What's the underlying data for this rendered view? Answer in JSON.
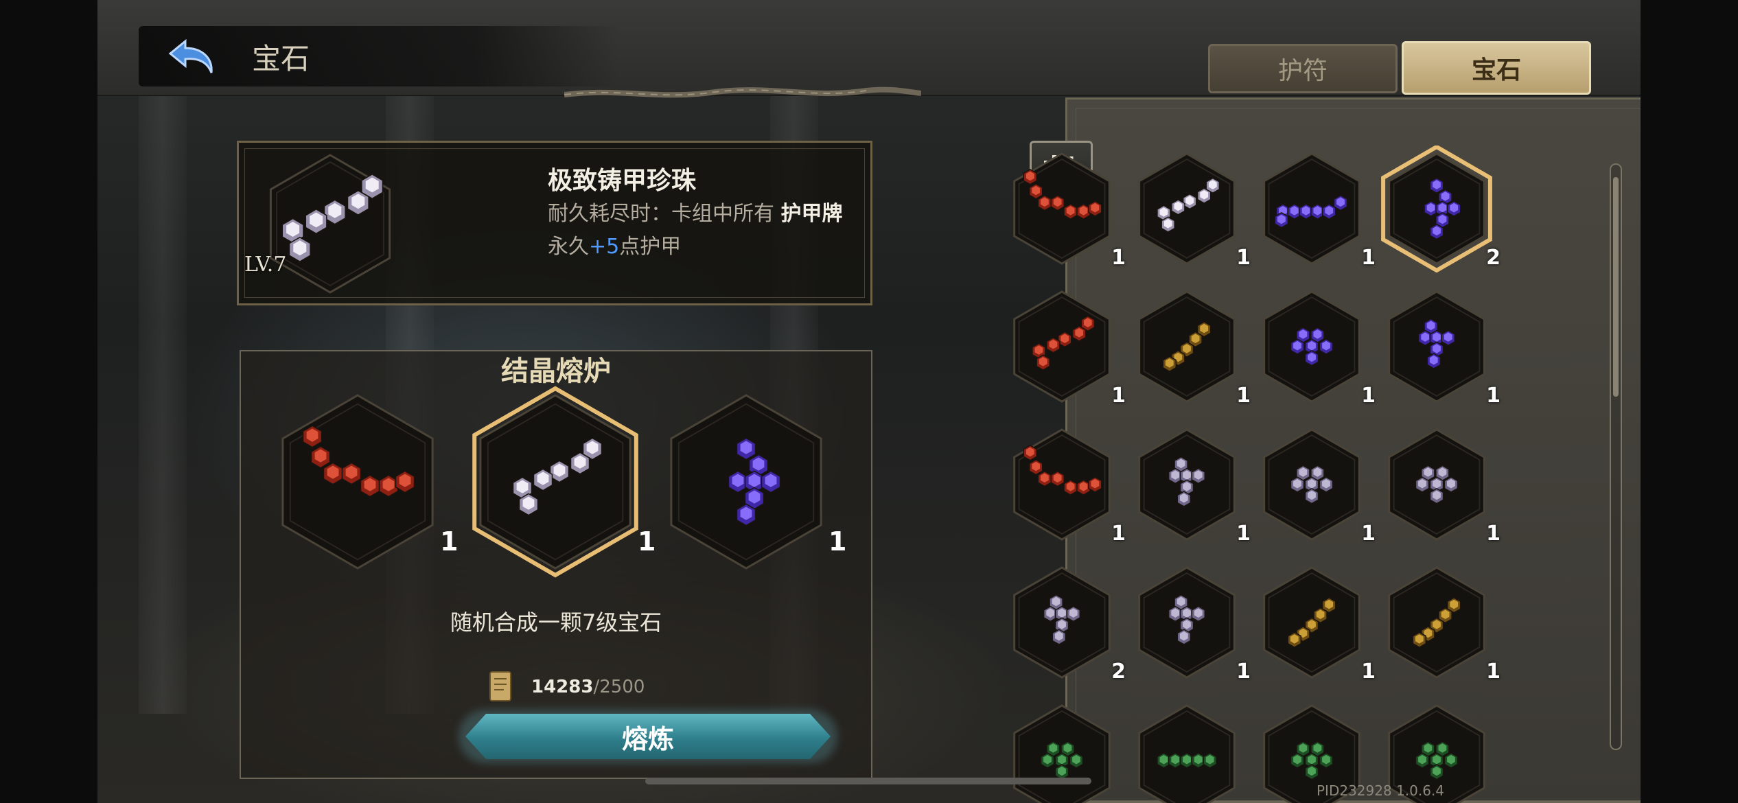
{
  "header": {
    "title": "宝石",
    "back_icon": "back-arrow-icon"
  },
  "tabs": [
    {
      "label": "护符",
      "active": false
    },
    {
      "label": "宝石",
      "active": true
    }
  ],
  "detail": {
    "name": "极致铸甲珍珠",
    "desc_prefix": "耐久耗尽时：卡组中所有 ",
    "desc_bold": "护甲牌",
    "desc_mid": " 永久",
    "desc_plus": "+5",
    "desc_suffix": "点护甲",
    "level": "LV.7"
  },
  "furnace": {
    "title": "结晶熔炉",
    "slots": [
      {
        "color": "red",
        "count": "1"
      },
      {
        "color": "white",
        "count": "1",
        "selected": true
      },
      {
        "color": "purple",
        "count": "1"
      }
    ],
    "hint": "随机合成一颗7级宝石",
    "cost_current": "14283",
    "cost_max": "/2500",
    "cost_icon": "scroll-icon",
    "button": "熔炼"
  },
  "inventory": {
    "filter_icon": "filter-sort-icon",
    "rows": [
      [
        {
          "color": "red",
          "count": "1"
        },
        {
          "color": "white",
          "count": "1"
        },
        {
          "color": "purple",
          "count": "1"
        },
        {
          "color": "purple",
          "count": "2",
          "selected": true
        }
      ],
      [
        {
          "color": "red",
          "count": "1"
        },
        {
          "color": "gold",
          "count": "1"
        },
        {
          "color": "purple",
          "count": "1"
        },
        {
          "color": "purple",
          "count": "1"
        }
      ],
      [
        {
          "color": "red",
          "count": "1"
        },
        {
          "color": "lavender",
          "count": "1"
        },
        {
          "color": "lavender",
          "count": "1"
        },
        {
          "color": "lavender",
          "count": "1"
        }
      ],
      [
        {
          "color": "lavender",
          "count": "2"
        },
        {
          "color": "lavender",
          "count": "1"
        },
        {
          "color": "gold",
          "count": "1"
        },
        {
          "color": "gold",
          "count": "1"
        }
      ],
      [
        {
          "color": "green",
          "count": ""
        },
        {
          "color": "green",
          "count": ""
        },
        {
          "color": "green",
          "count": ""
        },
        {
          "color": "green",
          "count": ""
        }
      ]
    ]
  },
  "version": "PID232928  1.0.6.4",
  "colors": {
    "red": "#c0351f",
    "white": "#c8c2d6",
    "purple": "#6b4fe0",
    "gold": "#a87d22",
    "lavender": "#9d96b4",
    "green": "#2f7a3a",
    "accent_tab": "#d2bf92",
    "button": "#3d97a3"
  }
}
